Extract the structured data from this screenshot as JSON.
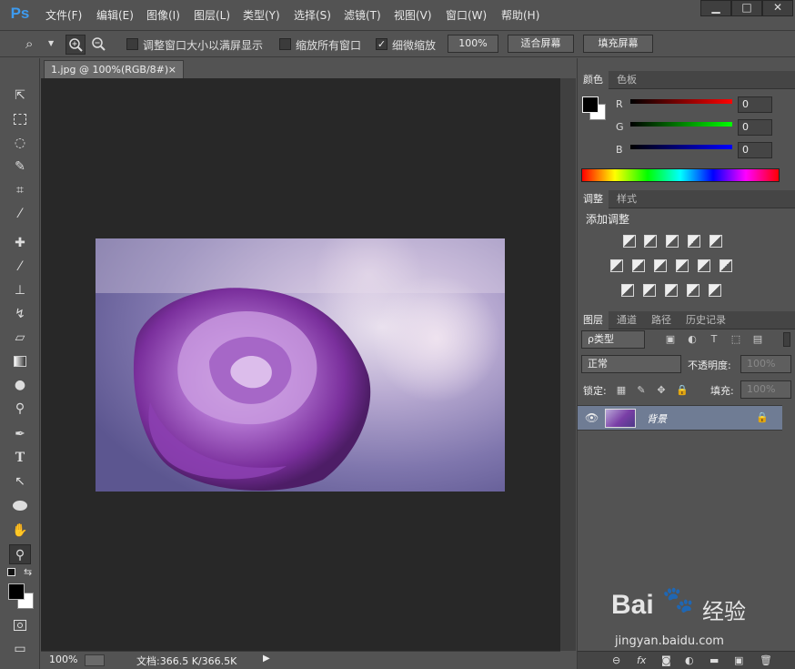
{
  "app": {
    "logo": "Ps"
  },
  "menu": [
    "文件(F)",
    "编辑(E)",
    "图像(I)",
    "图层(L)",
    "类型(Y)",
    "选择(S)",
    "滤镜(T)",
    "视图(V)",
    "窗口(W)",
    "帮助(H)"
  ],
  "window_controls": {
    "minimize": "▁",
    "maximize": "□",
    "close": "✕"
  },
  "options": {
    "resize_windows_label": "调整窗口大小以满屏显示",
    "zoom_all_label": "缩放所有窗口",
    "scrubby_zoom_label": "细微缩放",
    "btn_100": "100%",
    "btn_fit": "适合屏幕",
    "btn_fill": "填充屏幕"
  },
  "document": {
    "tab_title": "1.jpg @ 100%(RGB/8#)",
    "tab_close": "×"
  },
  "status": {
    "zoom": "100%",
    "doc_info": "文档:366.5 K/366.5K",
    "arrow": "▶"
  },
  "color_panel": {
    "tabs": [
      "颜色",
      "色板"
    ],
    "channels": [
      {
        "label": "R",
        "value": "0"
      },
      {
        "label": "G",
        "value": "0"
      },
      {
        "label": "B",
        "value": "0"
      }
    ]
  },
  "adjust_panel": {
    "tabs": [
      "调整",
      "样式"
    ],
    "title": "添加调整"
  },
  "layers_panel": {
    "tabs": [
      "图层",
      "通道",
      "路径",
      "历史记录"
    ],
    "filter_kind": "ρ类型",
    "blend_mode": "正常",
    "opacity_label": "不透明度:",
    "opacity_value": "100%",
    "lock_label": "锁定:",
    "fill_label": "填充:",
    "fill_value": "100%",
    "layers": [
      {
        "name": "背景"
      }
    ],
    "footer_icons": [
      "link-icon",
      "fx-icon",
      "mask-icon",
      "adjustment-icon",
      "folder-icon",
      "new-layer-icon",
      "trash-icon"
    ],
    "footer_labels": {
      "link": "⊖",
      "fx": "fx",
      "mask": "◙",
      "adjust": "◐",
      "folder": "▬",
      "new": "▣",
      "trash": "🗑"
    }
  },
  "watermark": {
    "brand": "Bai",
    "brand2": "经验",
    "url": "jingyan.baidu.com"
  },
  "colors": {
    "bg": "#535353",
    "canvas": "#282828",
    "accent": "#3d9bef"
  }
}
